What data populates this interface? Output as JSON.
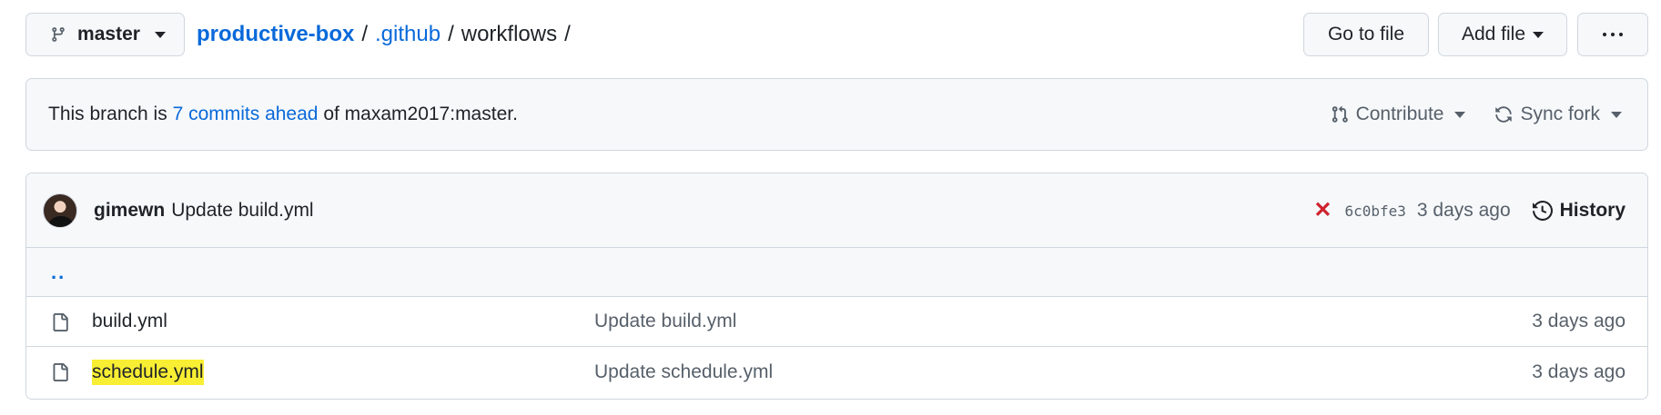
{
  "toolbar": {
    "branch": "master",
    "breadcrumb": {
      "repo": "productive-box",
      "sep": "/",
      "dir1": ".github",
      "dir2": "workflows"
    },
    "goto_label": "Go to file",
    "addfile_label": "Add file"
  },
  "ahead": {
    "prefix": "This branch is ",
    "link": "7 commits ahead",
    "suffix": " of maxam2017:master.",
    "contribute": "Contribute",
    "sync": "Sync fork"
  },
  "last_commit": {
    "author": "gimewn",
    "message": "Update build.yml",
    "sha": "6c0bfe3",
    "time": "3 days ago",
    "history_label": "History",
    "status_color": "#cf222e"
  },
  "parent_link": "..",
  "files": [
    {
      "name": "build.yml",
      "commit": "Update build.yml",
      "age": "3 days ago",
      "icon": "file-icon"
    },
    {
      "name": "schedule.yml",
      "commit": "Update schedule.yml",
      "age": "3 days ago",
      "icon": "file-icon",
      "highlighted": true
    }
  ],
  "colors": {
    "link": "#0969da",
    "highlight": "#f8ee33",
    "muted": "#57606a",
    "border": "#d0d7de",
    "subtle_bg": "#f6f8fa"
  }
}
